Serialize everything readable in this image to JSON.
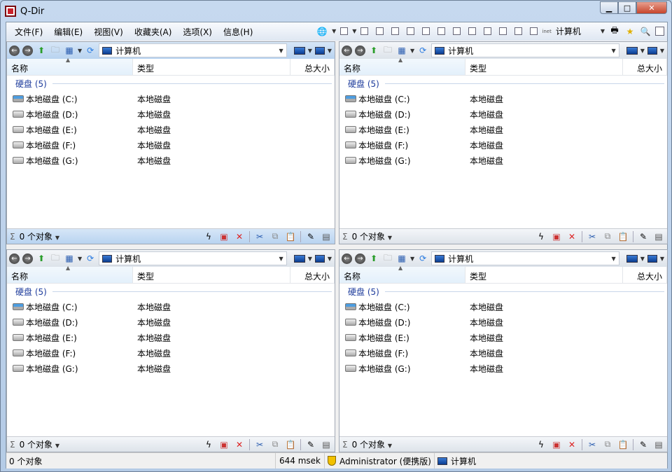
{
  "window": {
    "title": "Q-Dir"
  },
  "menu": [
    "文件(F)",
    "编辑(E)",
    "视图(V)",
    "收藏夹(A)",
    "选项(X)",
    "信息(H)"
  ],
  "toolbar": {
    "location": "计算机",
    "inet_label": "inet"
  },
  "columns": {
    "name": "名称",
    "type": "类型",
    "size": "总大小"
  },
  "group": "硬盘 (5)",
  "address": "计算机",
  "drives": [
    {
      "name": "本地磁盘 (C:)",
      "type": "本地磁盘",
      "icon": "system-drive-icon"
    },
    {
      "name": "本地磁盘 (D:)",
      "type": "本地磁盘",
      "icon": "drive-icon"
    },
    {
      "name": "本地磁盘 (E:)",
      "type": "本地磁盘",
      "icon": "drive-icon"
    },
    {
      "name": "本地磁盘 (F:)",
      "type": "本地磁盘",
      "icon": "drive-icon"
    },
    {
      "name": "本地磁盘 (G:)",
      "type": "本地磁盘",
      "icon": "drive-icon"
    }
  ],
  "pane_status": "0 个对象",
  "statusbar": {
    "objects": "0 个对象",
    "time": "644 msek",
    "user": "Administrator (便携版)",
    "location": "计算机"
  },
  "colors": {
    "active_pane": "#b8d3f0",
    "group_text": "#1e3c9c"
  }
}
